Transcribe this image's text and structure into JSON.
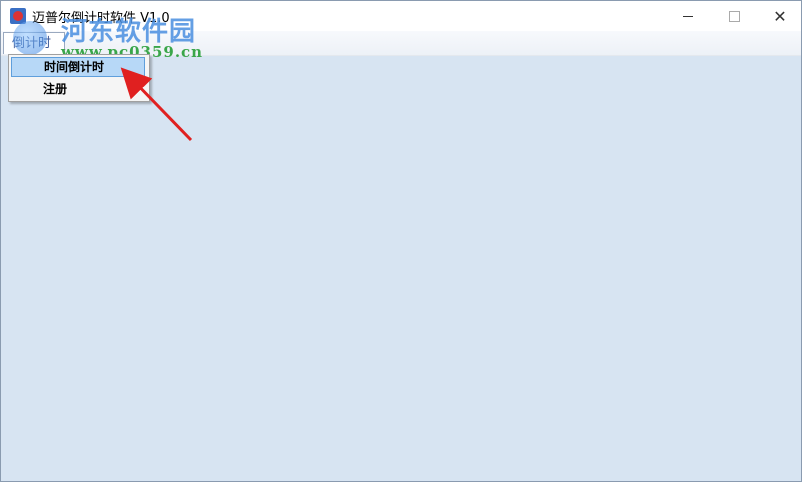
{
  "window": {
    "title": "迈普尔倒计时软件 V1.0",
    "controls": {
      "close_glyph": "✕"
    }
  },
  "menubar": {
    "top_menu_label": "倒计时"
  },
  "dropdown": {
    "items": [
      {
        "label": "时间倒计时"
      },
      {
        "label": "注册"
      }
    ]
  },
  "watermark": {
    "name": "河东软件园",
    "url": "www.pc0359.cn"
  },
  "colors": {
    "client_bg": "#d7e4f2",
    "highlight": "#b7d8f7",
    "arrow": "#e02020"
  }
}
